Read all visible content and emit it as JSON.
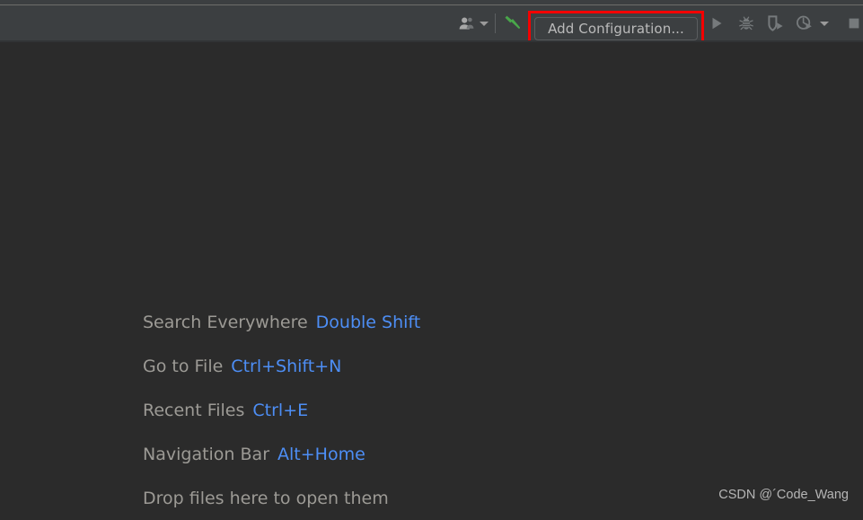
{
  "colors": {
    "toolbar_bg": "#3c3f41",
    "editor_bg": "#2b2b2b",
    "highlight_red": "#f40000",
    "shortcut_blue": "#4d8ef5",
    "hint_text": "#9c9a95",
    "button_text": "#bbbbbb",
    "icon_gray": "#7a7d7f",
    "hammer_green": "#49a64a"
  },
  "toolbar": {
    "left_icons": [
      {
        "name": "users-icon",
        "label": "Select Run/Debug User"
      },
      {
        "name": "chevron-down-icon",
        "label": "User dropdown"
      },
      {
        "name": "build-hammer-icon",
        "label": "Build Project"
      }
    ],
    "add_configuration": {
      "label": "Add Configuration...",
      "highlighted": true
    },
    "right_icons": [
      {
        "name": "run-play-icon",
        "label": "Run"
      },
      {
        "name": "debug-bug-icon",
        "label": "Debug"
      },
      {
        "name": "run-with-coverage-icon",
        "label": "Run with Coverage"
      },
      {
        "name": "profile-clock-icon",
        "label": "Profile"
      },
      {
        "name": "chevron-down-icon",
        "label": "More run options"
      },
      {
        "name": "stop-square-icon",
        "label": "Stop"
      }
    ]
  },
  "editor": {
    "hints": [
      {
        "action": "Search Everywhere",
        "keys": "Double Shift"
      },
      {
        "action": "Go to File",
        "keys": "Ctrl+Shift+N"
      },
      {
        "action": "Recent Files",
        "keys": "Ctrl+E"
      },
      {
        "action": "Navigation Bar",
        "keys": "Alt+Home"
      },
      {
        "action": "Drop files here to open them",
        "keys": ""
      }
    ]
  },
  "watermark": {
    "text": "CSDN @´Code_Wang"
  }
}
